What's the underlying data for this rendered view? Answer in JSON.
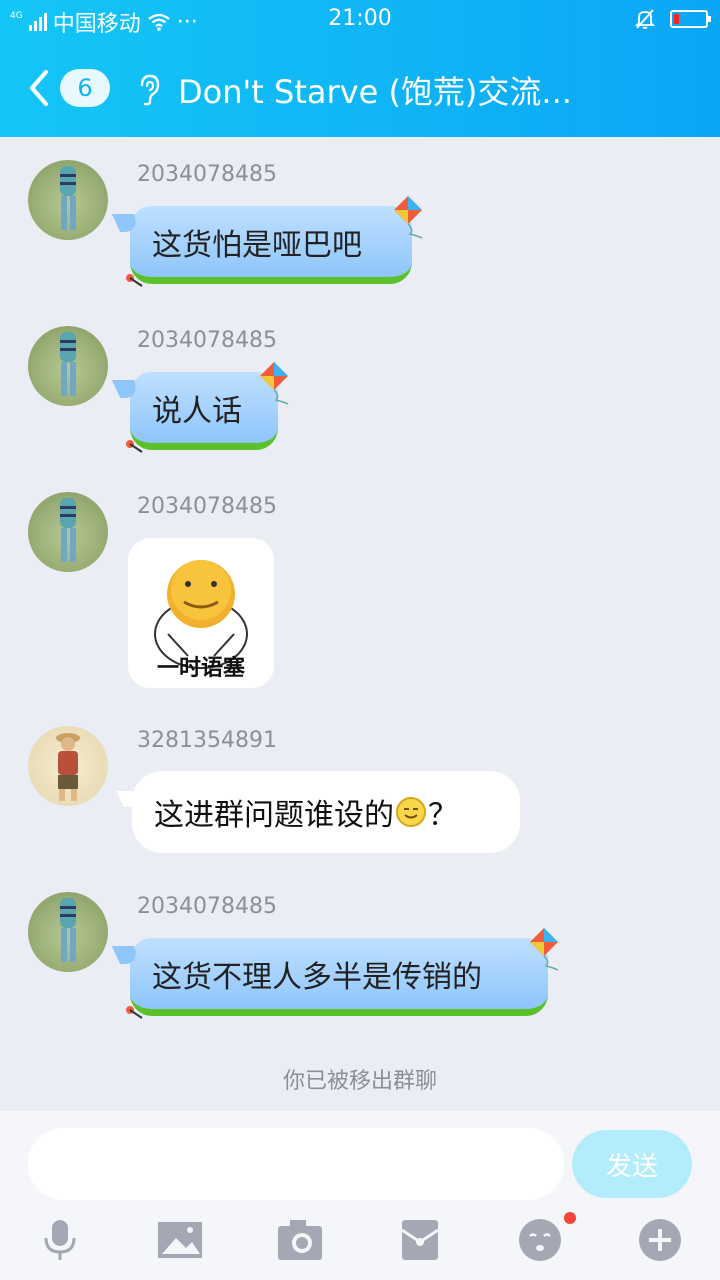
{
  "status_bar": {
    "network": "4G",
    "carrier": "中国移动",
    "dots": "···",
    "time": "21:00"
  },
  "nav": {
    "unread_count": "6",
    "title": "Don't Starve (饱荒)交流..."
  },
  "messages": [
    {
      "sender": "2034078485",
      "text": "这货怕是哑巴吧"
    },
    {
      "sender": "2034078485",
      "text": "说人话"
    },
    {
      "sender": "2034078485",
      "sticker_text": "一时语塞"
    },
    {
      "sender": "3281354891",
      "text": "这进群问题谁设的",
      "text_suffix": "？"
    },
    {
      "sender": "2034078485",
      "text": "这货不理人多半是传销的"
    }
  ],
  "system_note": "你已被移出群聊",
  "input": {
    "placeholder": "",
    "send_label": "发送"
  },
  "colors": {
    "header": "#0fb3f5",
    "background": "#eaedf4",
    "bubble_blue": "#8ec5fb",
    "bubble_grass": "#5bc12a",
    "send_button": "#b3ecfc",
    "badge_dot": "#f4453a"
  },
  "toolbar_icons": [
    "microphone-icon",
    "image-icon",
    "camera-icon",
    "red-packet-icon",
    "emoji-icon",
    "plus-icon"
  ]
}
